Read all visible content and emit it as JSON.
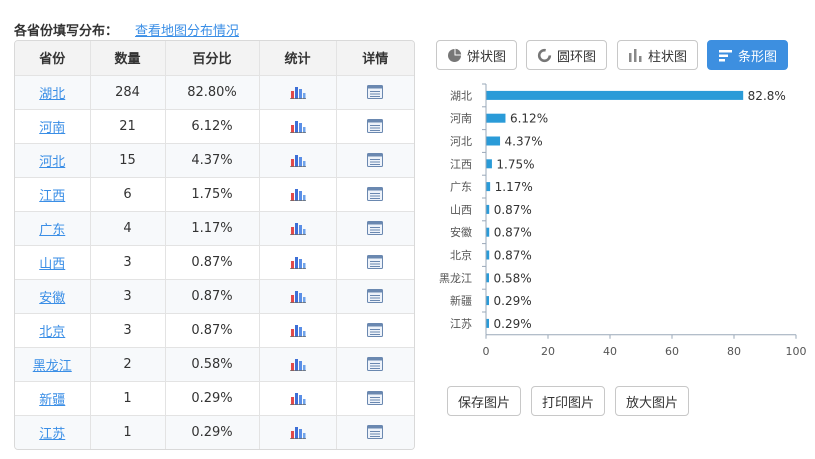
{
  "header": {
    "title": "各省份填写分布：",
    "map_link": "查看地图分布情况"
  },
  "table": {
    "columns": [
      "省份",
      "数量",
      "百分比",
      "统计",
      "详情"
    ],
    "rows": [
      {
        "province": "湖北",
        "count": "284",
        "percent": "82.80%"
      },
      {
        "province": "河南",
        "count": "21",
        "percent": "6.12%"
      },
      {
        "province": "河北",
        "count": "15",
        "percent": "4.37%"
      },
      {
        "province": "江西",
        "count": "6",
        "percent": "1.75%"
      },
      {
        "province": "广东",
        "count": "4",
        "percent": "1.17%"
      },
      {
        "province": "山西",
        "count": "3",
        "percent": "0.87%"
      },
      {
        "province": "安徽",
        "count": "3",
        "percent": "0.87%"
      },
      {
        "province": "北京",
        "count": "3",
        "percent": "0.87%"
      },
      {
        "province": "黑龙江",
        "count": "2",
        "percent": "0.58%"
      },
      {
        "province": "新疆",
        "count": "1",
        "percent": "0.29%"
      },
      {
        "province": "江苏",
        "count": "1",
        "percent": "0.29%"
      }
    ]
  },
  "chart_tabs": [
    {
      "label": "饼状图",
      "icon": "pie-icon",
      "active": false
    },
    {
      "label": "圆环图",
      "icon": "ring-icon",
      "active": false
    },
    {
      "label": "柱状图",
      "icon": "column-icon",
      "active": false
    },
    {
      "label": "条形图",
      "icon": "bar-icon",
      "active": true
    }
  ],
  "chart_data": {
    "type": "bar",
    "orientation": "horizontal",
    "categories": [
      "湖北",
      "河南",
      "河北",
      "江西",
      "广东",
      "山西",
      "安徽",
      "北京",
      "黑龙江",
      "新疆",
      "江苏"
    ],
    "values": [
      82.8,
      6.12,
      4.37,
      1.75,
      1.17,
      0.87,
      0.87,
      0.87,
      0.58,
      0.29,
      0.29
    ],
    "value_labels": [
      "82.8%",
      "6.12%",
      "4.37%",
      "1.75%",
      "1.17%",
      "0.87%",
      "0.87%",
      "0.87%",
      "0.58%",
      "0.29%",
      "0.29%"
    ],
    "xlim": [
      0,
      100
    ],
    "xticks": [
      0,
      20,
      40,
      60,
      80,
      100
    ],
    "grid": false,
    "bar_color": "#2a9bd8"
  },
  "actions": {
    "save": "保存图片",
    "print": "打印图片",
    "zoom": "放大图片"
  },
  "colors": {
    "accent": "#3d8fe0",
    "link": "#3a8ee6"
  }
}
